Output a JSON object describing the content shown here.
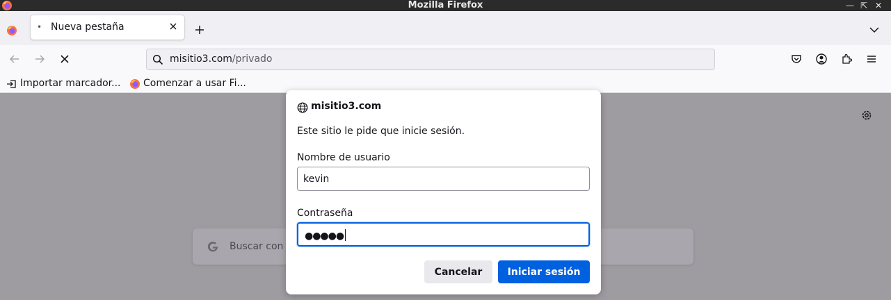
{
  "window": {
    "title": "Mozilla Firefox",
    "controls": [
      "minimize",
      "restore",
      "close"
    ]
  },
  "tabs": [
    {
      "label": "Nueva pestaña",
      "active": true
    }
  ],
  "navbar": {
    "url_host": "misitio3.com",
    "url_path": "/privado"
  },
  "bookmarks": [
    {
      "label": "Importar marcador...",
      "icon": "import-icon"
    },
    {
      "label": "Comenzar a usar Fi...",
      "icon": "firefox-icon"
    }
  ],
  "newtab_page": {
    "search_placeholder": "Buscar con G"
  },
  "auth_dialog": {
    "host": "misitio3.com",
    "message": "Este sitio le pide que inicie sesión.",
    "username_label": "Nombre de usuario",
    "username_value": "kevin",
    "password_label": "Contraseña",
    "password_mask": "●●●●●",
    "cancel_label": "Cancelar",
    "submit_label": "Iniciar sesión"
  },
  "colors": {
    "accent": "#0061e0",
    "titlebar": "#2b2b2b",
    "overlay": "#9e9ca1"
  }
}
